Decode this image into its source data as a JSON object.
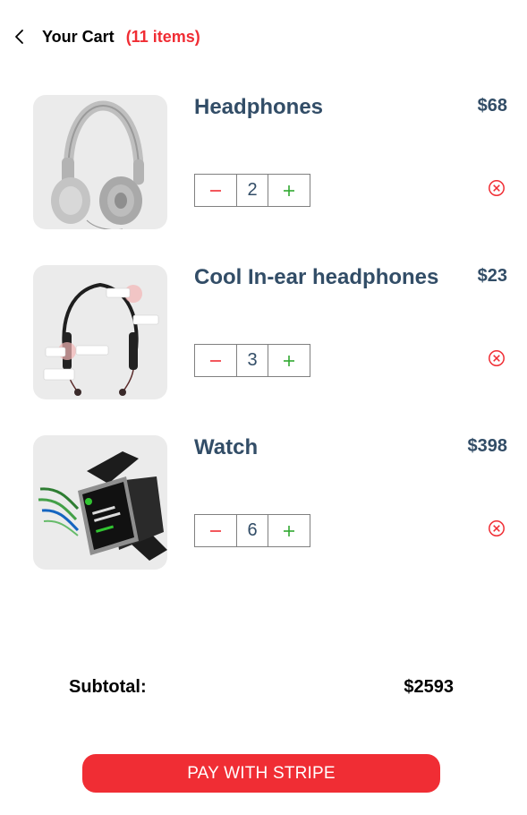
{
  "header": {
    "title": "Your Cart",
    "count": "(11 items)"
  },
  "items": [
    {
      "name": "Headphones",
      "price": "$68",
      "quantity": "2",
      "image": "headphones-image"
    },
    {
      "name": "Cool In-ear headphones",
      "price": "$23",
      "quantity": "3",
      "image": "neckband-earphones-image"
    },
    {
      "name": "Watch",
      "price": "$398",
      "quantity": "6",
      "image": "smartwatch-image"
    }
  ],
  "subtotal": {
    "label": "Subtotal:",
    "value": "$2593"
  },
  "pay_button": {
    "label": "PAY WITH STRIPE"
  },
  "colors": {
    "accent": "#f02d34",
    "text": "#324d67",
    "plus": "#31a831",
    "image_bg": "#ebebeb"
  }
}
